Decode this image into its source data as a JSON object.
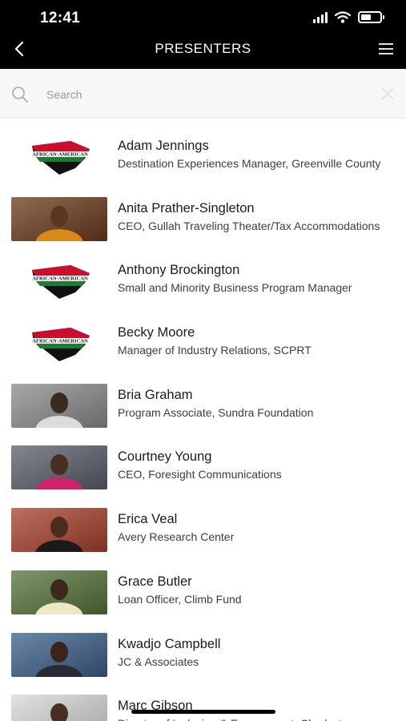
{
  "status_bar": {
    "time": "12:41"
  },
  "nav": {
    "title": "PRESENTERS"
  },
  "search": {
    "placeholder": "Search"
  },
  "presenters": [
    {
      "name": "Adam Jennings",
      "title": "Destination Experiences Manager, Greenville County",
      "photo": "logo",
      "logo_text": "AFRICAN-AMERICAN"
    },
    {
      "name": "Anita Prather-Singleton",
      "title": "CEO, Gullah Traveling Theater/Tax Accommodations",
      "photo": "person"
    },
    {
      "name": "Anthony Brockington",
      "title": "Small and Minority Business Program Manager",
      "photo": "logo",
      "logo_text": "AFRICAN-AMERICAN"
    },
    {
      "name": "Becky Moore",
      "title": "Manager of Industry Relations, SCPRT",
      "photo": "logo",
      "logo_text": "AFRICAN-AMERICAN"
    },
    {
      "name": "Bria Graham",
      "title": "Program Associate, Sundra Foundation",
      "photo": "person"
    },
    {
      "name": "Courtney Young",
      "title": "CEO, Foresight Communications",
      "photo": "person"
    },
    {
      "name": "Erica Veal",
      "title": "Avery Research Center",
      "photo": "person"
    },
    {
      "name": "Grace Butler",
      "title": "Loan Officer, Climb Fund",
      "photo": "person"
    },
    {
      "name": "Kwadjo Campbell",
      "title": "JC & Associates",
      "photo": "person"
    },
    {
      "name": "Marc Gibson",
      "title": "Director of Inclusion & Engagement, Charleston",
      "photo": "person"
    }
  ],
  "colors": {
    "header_bg": "#000000",
    "logo_red": "#c8102e",
    "logo_green": "#1e7b34",
    "logo_black": "#111111"
  }
}
